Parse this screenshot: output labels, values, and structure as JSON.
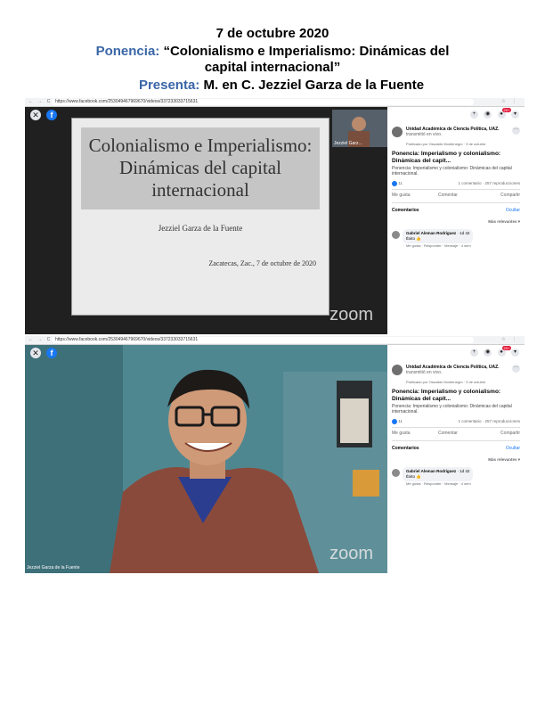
{
  "header": {
    "date": "7 de octubre 2020",
    "ponencia_label": "Ponencia:",
    "ponencia_title": "“Colonialismo e Imperialismo: Dinámicas del capital internacional”",
    "presenta_label": "Presenta:",
    "presenta_name": "M. en C. Jezziel Garza de la Fuente"
  },
  "browser": {
    "nav_glyphs": "← → C ⌂",
    "url": "https://www.facebook.com/253049467969670/videos/337233033715631",
    "right_glyphs": "☆ ⋮"
  },
  "viewer": {
    "close_glyph": "✕",
    "fb_glyph": "f",
    "zoom_watermark": "zoom"
  },
  "slide": {
    "title": "Colonialismo e Imperialismo: Dinámicas del capital internacional",
    "author": "Jezziel Garza de la Fuente",
    "place_date": "Zacatecas, Zac., 7 de octubre de 2020"
  },
  "thumbnail": {
    "label": "Jezziel Garz..."
  },
  "speaker": {
    "name": "Jezziel Garza de la Fuente"
  },
  "topbar": {
    "plus": "+",
    "messenger": "◉",
    "bell": "●",
    "badge": "20+",
    "menu": "▾"
  },
  "post": {
    "page_name": "Unidad Académica de Ciencia Política, UAZ.",
    "page_suffix": "transmitió en vivo.",
    "meta": "Publicado por Oswaldo Montenegro · 3 de octubre",
    "more": "···",
    "title": "Ponencia: Imperialismo y colonialismo: Dinámicas del capit...",
    "desc": "Ponencia: Imperialismo y colonialismo: Dinámicas del capital internacional.",
    "likes": "11",
    "stats": "1 comentario · 257 reproducciones",
    "like_btn": "Me gusta",
    "comment_btn": "Comentar",
    "share_btn": "Compartir"
  },
  "comments": {
    "header": "Comentarios",
    "hide": "Ocultar",
    "relevance": "Más relevantes ▾",
    "items": [
      {
        "author": "Gabriel Aleman Rodriguez",
        "time": "1d 42",
        "text": "Éxito 👍",
        "actions": "Me gusta · Responder · Mensaje · 4 sem"
      }
    ]
  }
}
